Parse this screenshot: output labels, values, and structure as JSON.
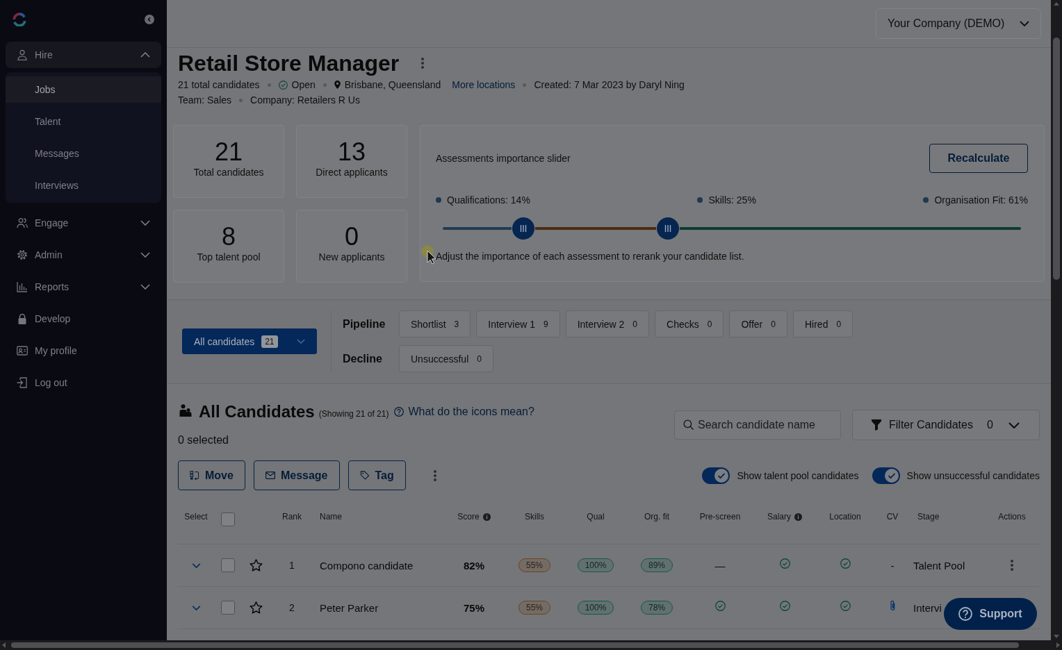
{
  "sidebar": {
    "items": [
      {
        "label": "Hire",
        "kind": "group",
        "expanded": true,
        "children": [
          {
            "label": "Jobs",
            "selected": true
          },
          {
            "label": "Talent",
            "selected": false
          },
          {
            "label": "Messages",
            "selected": false
          },
          {
            "label": "Interviews",
            "selected": false
          }
        ]
      },
      {
        "label": "Engage",
        "kind": "group",
        "expanded": false
      },
      {
        "label": "Admin",
        "kind": "group",
        "expanded": false
      },
      {
        "label": "Reports",
        "kind": "group",
        "expanded": false
      },
      {
        "label": "Develop",
        "kind": "link"
      },
      {
        "label": "My profile",
        "kind": "link"
      },
      {
        "label": "Log out",
        "kind": "link"
      }
    ]
  },
  "company_select": {
    "value": "Your Company (DEMO)"
  },
  "job": {
    "title": "Retail Store Manager",
    "meta_lines": [
      [
        {
          "kind": "text",
          "text": "21 total candidates"
        },
        {
          "kind": "status",
          "text": "Open"
        },
        {
          "kind": "location",
          "text": "Brisbane, Queensland"
        },
        {
          "kind": "link",
          "text": "More locations"
        },
        {
          "kind": "text",
          "text": "Created: 7 Mar 2023 by Daryl Ning"
        }
      ],
      [
        {
          "kind": "text",
          "text": "Team: Sales"
        },
        {
          "kind": "text",
          "text": "Company: Retailers R Us"
        }
      ]
    ]
  },
  "stats": [
    {
      "value": "21",
      "label": "Total candidates"
    },
    {
      "value": "13",
      "label": "Direct applicants"
    },
    {
      "value": "8",
      "label": "Top talent pool"
    },
    {
      "value": "0",
      "label": "New applicants"
    }
  ],
  "assessment": {
    "title": "Assessments importance slider",
    "button": "Recalculate",
    "segments": [
      {
        "label": "Qualifications: 14%",
        "level": 0.14,
        "color": "#1f3c52"
      },
      {
        "label": "Skills: 25%",
        "level": 0.25,
        "color": "#4d2c12"
      },
      {
        "label": "Organisation Fit: 61%",
        "level": 0.61,
        "color": "#0e3c32"
      }
    ],
    "note": "Adjust the importance of each assessment to rerank your candidate list."
  },
  "stage_filter": {
    "all_button": {
      "label": "All candidates",
      "count": "21",
      "selected": true
    },
    "groups": [
      {
        "label": "Pipeline",
        "stages": [
          {
            "label": "Shortlist",
            "count": "3",
            "selected": false
          },
          {
            "label": "Interview 1",
            "count": "9",
            "selected": false
          },
          {
            "label": "Interview 2",
            "count": "0",
            "selected": false
          },
          {
            "label": "Checks",
            "count": "0",
            "selected": false
          },
          {
            "label": "Offer",
            "count": "0",
            "selected": false
          },
          {
            "label": "Hired",
            "count": "0",
            "selected": false
          }
        ]
      },
      {
        "label": "Decline",
        "stages": [
          {
            "label": "Unsuccessful",
            "count": "0",
            "selected": false
          }
        ]
      }
    ]
  },
  "candidates": {
    "title": "All Candidates",
    "showing": "(Showing 21 of 21)",
    "help_link": "What do the icons mean?",
    "selected_count": "0 selected",
    "actions": [
      "Move",
      "Message",
      "Tag"
    ],
    "search": {
      "placeholder": "Search candidate name"
    },
    "filter": {
      "label": "Filter Candidates",
      "count": "0"
    },
    "toggles": [
      {
        "label": "Show talent pool candidates",
        "on": true
      },
      {
        "label": "Show unsuccessful candidates",
        "on": true
      }
    ]
  },
  "table": {
    "select_all": {
      "checked": false
    },
    "columns": [
      {
        "label": "Select"
      },
      {
        "label": "Rank"
      },
      {
        "label": "Name"
      },
      {
        "label": "Score",
        "info": true
      },
      {
        "label": "Skills"
      },
      {
        "label": "Qual"
      },
      {
        "label": "Org. fit"
      },
      {
        "label": "Pre-screen"
      },
      {
        "label": "Salary",
        "info": true
      },
      {
        "label": "Location"
      },
      {
        "label": "CV"
      },
      {
        "label": "Stage"
      },
      {
        "label": "Actions"
      }
    ],
    "rows": [
      {
        "expanded": false,
        "checked": false,
        "starred": false,
        "rank": "1",
        "name": "Compono candidate",
        "score": "82%",
        "skills": {
          "value": "55%",
          "color": "#6b4519"
        },
        "qual": {
          "value": "100%",
          "color": "#14584a"
        },
        "org_fit": {
          "value": "89%",
          "color": "#14584a"
        },
        "pre_screen": {
          "kind": "text",
          "text": "—"
        },
        "salary": {
          "kind": "check"
        },
        "location": {
          "kind": "check"
        },
        "cv": {
          "kind": "text",
          "text": "-"
        },
        "stage": "Talent Pool"
      },
      {
        "expanded": false,
        "checked": false,
        "starred": false,
        "rank": "2",
        "name": "Peter Parker",
        "score": "75%",
        "skills": {
          "value": "55%",
          "color": "#6b4519"
        },
        "qual": {
          "value": "100%",
          "color": "#14584a"
        },
        "org_fit": {
          "value": "78%",
          "color": "#14584a"
        },
        "pre_screen": {
          "kind": "check"
        },
        "salary": {
          "kind": "check"
        },
        "location": {
          "kind": "check"
        },
        "cv": {
          "kind": "attachment"
        },
        "stage": "Intervi"
      }
    ]
  },
  "support_button": {
    "label": "Support"
  }
}
